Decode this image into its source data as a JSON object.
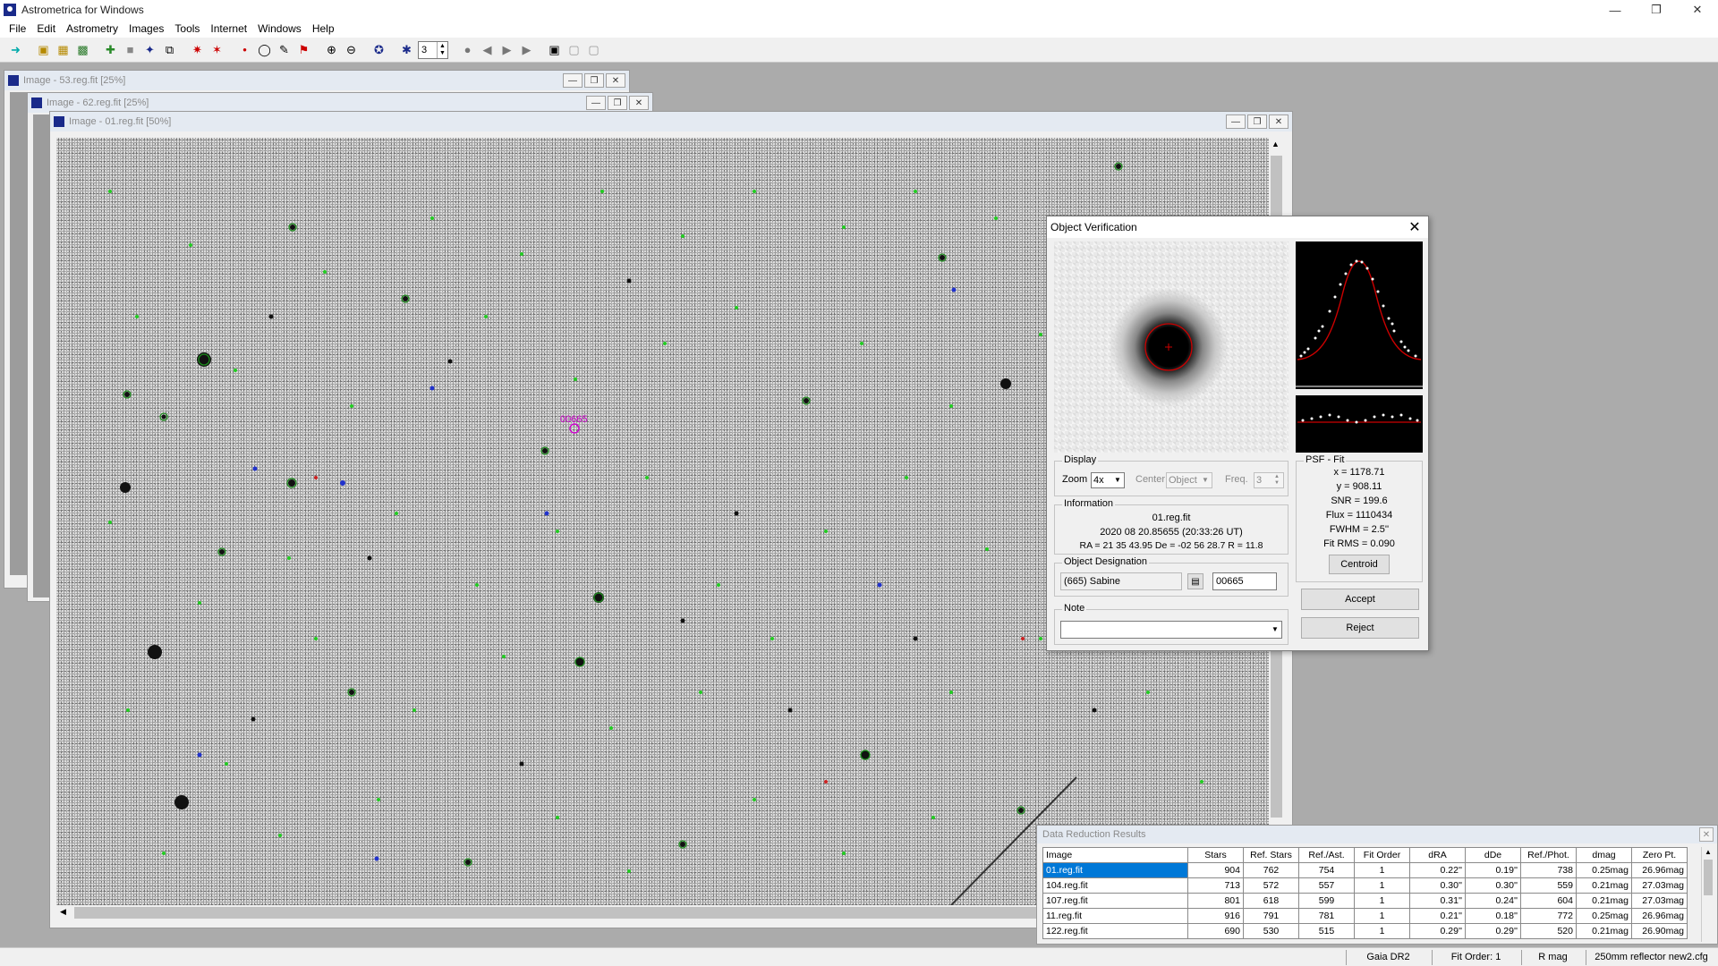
{
  "app": {
    "title": "Astrometrica for Windows"
  },
  "menu": [
    "File",
    "Edit",
    "Astrometry",
    "Images",
    "Tools",
    "Internet",
    "Windows",
    "Help"
  ],
  "toolbar": {
    "frame_spin_value": "3"
  },
  "windows": {
    "back1_title": "Image - 53.reg.fit [25%]",
    "back2_title": "Image - 62.reg.fit [25%]",
    "main_title": "Image - 01.reg.fit [50%]",
    "object_label": "00665"
  },
  "dialog": {
    "title": "Object Verification",
    "display": {
      "legend": "Display",
      "zoom_label": "Zoom",
      "zoom_value": "4x",
      "center_label": "Center",
      "center_value": "Object",
      "freq_label": "Freq.",
      "freq_value": "3"
    },
    "info": {
      "legend": "Information",
      "file": "01.reg.fit",
      "date": "2020 08 20.85655 (20:33:26 UT)",
      "coords": "RA = 21 35 43.95   De = -02 56 28.7   R = 11.8"
    },
    "designation": {
      "legend": "Object Designation",
      "name": "(665) Sabine",
      "number": "00665"
    },
    "note": {
      "legend": "Note",
      "value": ""
    },
    "psf": {
      "legend": "PSF - Fit",
      "x": "x = 1178.71",
      "y": "y = 908.11",
      "snr": "SNR = 199.6",
      "flux": "Flux = 1110434",
      "fwhm": "FWHM = 2.5''",
      "fitrms": "Fit RMS = 0.090",
      "centroid_label": "Centroid"
    },
    "accept_label": "Accept",
    "reject_label": "Reject"
  },
  "results": {
    "title": "Data Reduction Results",
    "columns": [
      "Image",
      "Stars",
      "Ref. Stars",
      "Ref./Ast.",
      "Fit Order",
      "dRA",
      "dDe",
      "Ref./Phot.",
      "dmag",
      "Zero Pt."
    ],
    "rows": [
      [
        "01.reg.fit",
        "904",
        "762",
        "754",
        "1",
        "0.22''",
        "0.19''",
        "738",
        "0.25mag",
        "26.96mag"
      ],
      [
        "104.reg.fit",
        "713",
        "572",
        "557",
        "1",
        "0.30''",
        "0.30''",
        "559",
        "0.21mag",
        "27.03mag"
      ],
      [
        "107.reg.fit",
        "801",
        "618",
        "599",
        "1",
        "0.31''",
        "0.24''",
        "604",
        "0.21mag",
        "27.03mag"
      ],
      [
        "11.reg.fit",
        "916",
        "791",
        "781",
        "1",
        "0.21''",
        "0.18''",
        "772",
        "0.25mag",
        "26.96mag"
      ],
      [
        "122.reg.fit",
        "690",
        "530",
        "515",
        "1",
        "0.29''",
        "0.29''",
        "520",
        "0.21mag",
        "26.90mag"
      ]
    ]
  },
  "status": {
    "catalog": "Gaia DR2",
    "fit_order": "Fit Order: 1",
    "band": "R mag",
    "config": "250mm reflector new2.cfg"
  },
  "colors": {
    "accent": "#0078d7",
    "object_label": "#cc00cc",
    "psf_curve": "#cc0000"
  }
}
